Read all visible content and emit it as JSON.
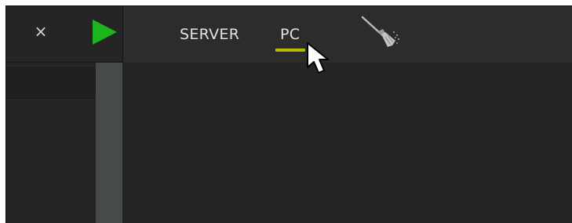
{
  "toolbar": {
    "close_symbol": "×",
    "play_icon": "play-icon",
    "tabs": [
      {
        "label": "SERVER"
      },
      {
        "label": "PC"
      }
    ],
    "active_tab": "PC",
    "clear_icon": "broom-icon"
  },
  "colors": {
    "background": "#252525",
    "toolbar": "#2c2c2c",
    "play_green": "#1db51d",
    "tab_underline": "#b9b900",
    "scrollbar": "#474a4a",
    "text": "#e2e2e2"
  }
}
